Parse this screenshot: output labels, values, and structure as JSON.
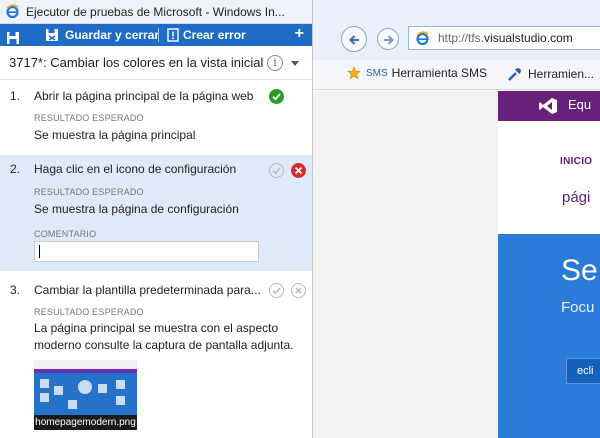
{
  "runner": {
    "window_title": "Ejecutor de pruebas de Microsoft - Windows In...",
    "toolbar": {
      "save_close_label": "Guardar y cerrar",
      "create_bug_label": "Crear error",
      "add_label": "+"
    },
    "test_title": "3717*: Cambiar los colores en la vista inicial",
    "info_glyph": "i",
    "steps": [
      {
        "number": "1.",
        "action": "Abrir la página principal de la página web",
        "expected_label": "RESULTADO ESPERADO",
        "expected": "Se muestra la página principal",
        "status": "passed"
      },
      {
        "number": "2.",
        "action": "Haga clic en el icono de configuración",
        "expected_label": "RESULTADO ESPERADO",
        "expected": "Se muestra la página de configuración",
        "comment_label": "COMENTARIO",
        "comment_value": "",
        "status": "failed"
      },
      {
        "number": "3.",
        "action": "Cambiar la plantilla predeterminada para...",
        "expected_label": "RESULTADO ESPERADO",
        "expected_line1": "La página principal se muestra con el aspecto",
        "expected_line2": "moderno consulte la captura de pantalla adjunta.",
        "attachment": "homepagemodern.png",
        "status": "none"
      }
    ]
  },
  "browser": {
    "url_prefix": "http://tfs.",
    "url_host": "visualstudio.com",
    "favorites": [
      {
        "badge": "SMS",
        "label": "Herramienta SMS"
      },
      {
        "label": "Herramien..."
      }
    ],
    "page": {
      "brand": "Equ",
      "nav_home": "INICIO",
      "section_title": "pági",
      "hero_title": "Se",
      "hero_sub": "Focu",
      "cta": "ecli"
    }
  },
  "colors": {
    "accent": "#1e6cc8",
    "passed": "#2d9a2d",
    "failed": "#d82d2d",
    "vs_purple": "#68217a",
    "hero_blue": "#2a7ad8"
  }
}
